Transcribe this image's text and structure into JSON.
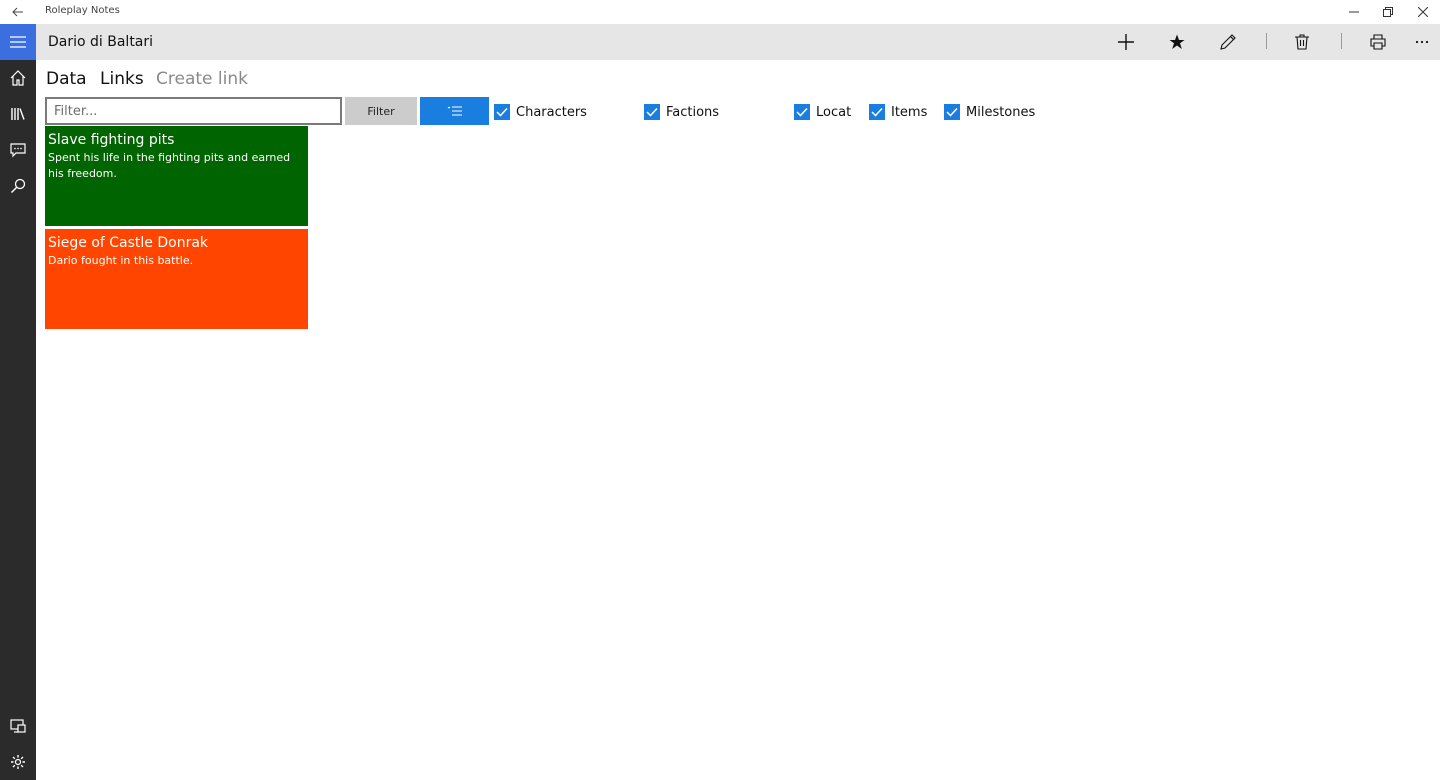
{
  "window": {
    "title": "Roleplay Notes",
    "icons": {
      "back": "back-arrow-icon",
      "minimize": "minimize-icon",
      "restore": "restore-icon",
      "close": "close-icon"
    }
  },
  "rail": {
    "items": [
      {
        "name": "hamburger-menu",
        "icon": "hamburger-icon"
      },
      {
        "name": "home",
        "icon": "home-icon"
      },
      {
        "name": "library",
        "icon": "library-icon"
      },
      {
        "name": "messages",
        "icon": "chat-icon"
      },
      {
        "name": "search",
        "icon": "search-icon"
      },
      {
        "name": "devices",
        "icon": "device-sync-icon"
      },
      {
        "name": "settings",
        "icon": "gear-icon"
      }
    ],
    "colors": {
      "background": "#2b2b2b",
      "active": "#3b6fe0"
    }
  },
  "header": {
    "title": "Dario di Baltari",
    "commands": [
      "add-icon",
      "star-icon",
      "edit-pencil-icon",
      "delete-icon",
      "print-icon",
      "more-icon"
    ]
  },
  "tabs": [
    {
      "label": "Data",
      "active": false
    },
    {
      "label": "Links",
      "active": true
    },
    {
      "label": "Create link",
      "active": false
    }
  ],
  "filter": {
    "placeholder": "Filter...",
    "value": "",
    "button_label": "Filter",
    "sort_icon": "sort-list-icon",
    "accent": "#1a7ee0"
  },
  "checkboxes": [
    {
      "label": "Characters",
      "checked": true
    },
    {
      "label": "Factions",
      "checked": true
    },
    {
      "label": "Locat",
      "checked": true
    },
    {
      "label": "Items",
      "checked": true
    },
    {
      "label": "Milestones",
      "checked": true
    }
  ],
  "cards": [
    {
      "title": "Slave fighting pits",
      "description": "Spent his life in the fighting pits and earned his freedom.",
      "color": "#006400"
    },
    {
      "title": "Siege of Castle Donrak",
      "description": "Dario fought in this battle.",
      "color": "#ff4500"
    }
  ]
}
